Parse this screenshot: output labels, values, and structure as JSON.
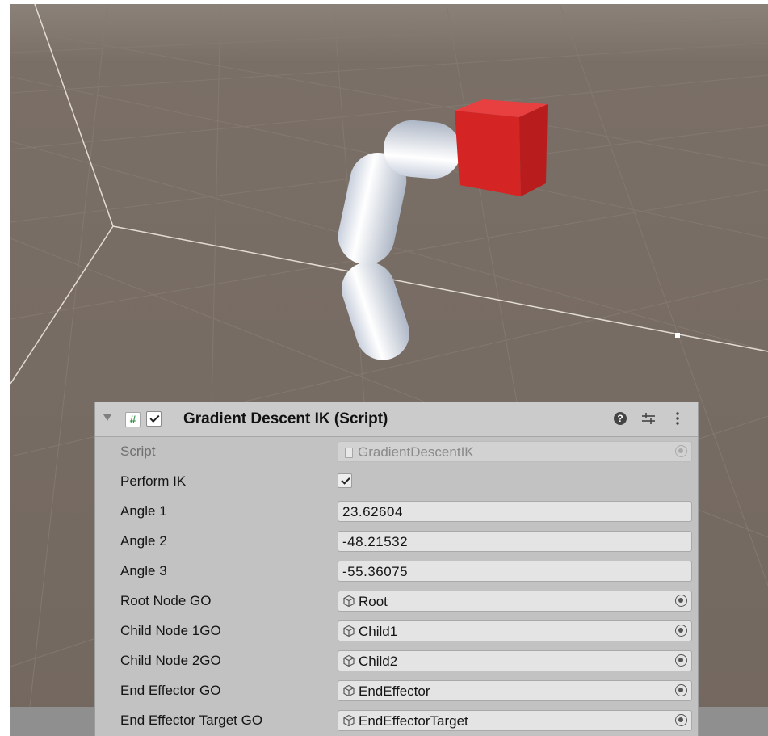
{
  "component": {
    "title": "Gradient Descent IK (Script)",
    "enabled": true,
    "icon": "hash-script-icon"
  },
  "properties": {
    "script": {
      "label": "Script",
      "value": "GradientDescentIK"
    },
    "perform_ik": {
      "label": "Perform IK",
      "checked": true
    },
    "angle1": {
      "label": "Angle 1",
      "value": "23.62604"
    },
    "angle2": {
      "label": "Angle 2",
      "value": "-48.21532"
    },
    "angle3": {
      "label": "Angle 3",
      "value": "-55.36075"
    },
    "root_node": {
      "label": "Root Node GO",
      "value": "Root"
    },
    "child_node1": {
      "label": "Child Node 1GO",
      "value": "Child1"
    },
    "child_node2": {
      "label": "Child Node 2GO",
      "value": "Child2"
    },
    "end_effector": {
      "label": "End Effector GO",
      "value": "EndEffector"
    },
    "end_effector_target": {
      "label": "End Effector Target GO",
      "value": "EndEffectorTarget"
    }
  },
  "colors": {
    "ground": "#776b63",
    "grid_line": "#8c8178",
    "segment": "#e6ebf3",
    "end_effector_cube": "#d42424",
    "panel": "#c2c2c2"
  }
}
